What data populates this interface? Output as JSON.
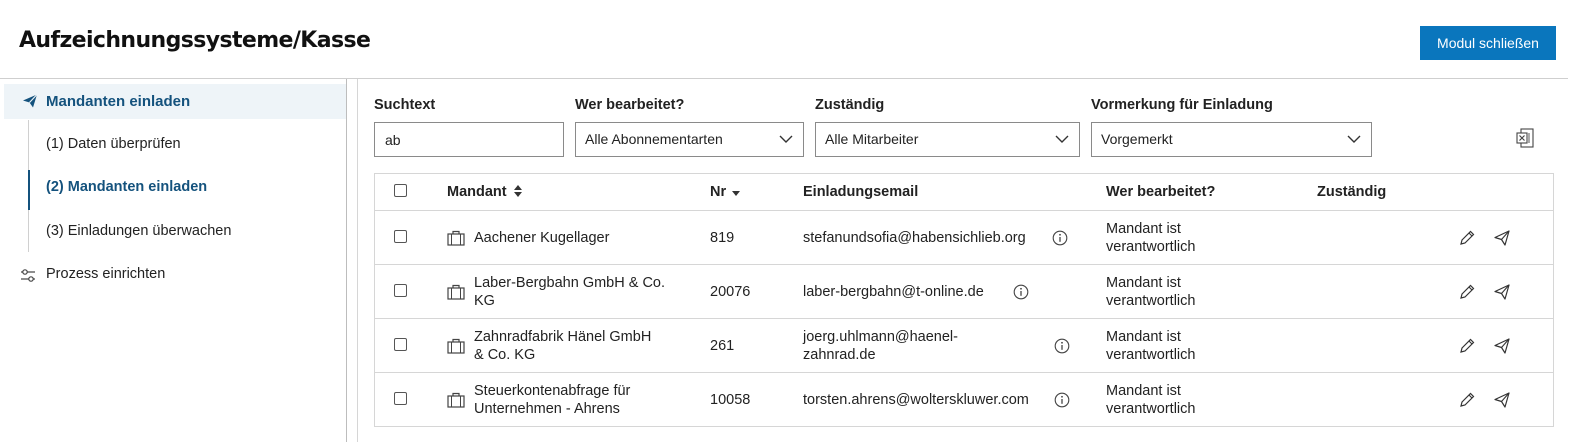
{
  "header": {
    "title": "Aufzeichnungssysteme/Kasse",
    "close_button": "Modul schließen"
  },
  "sidebar": {
    "main_item": "Mandanten einladen",
    "sub_items": [
      "(1) Daten überprüfen",
      "(2) Mandanten einladen",
      "(3) Einladungen überwachen"
    ],
    "process_item": "Prozess einrichten"
  },
  "filters": {
    "search": {
      "label": "Suchtext",
      "value": "ab"
    },
    "editor": {
      "label": "Wer bearbeitet?",
      "value": "Alle Abonnementarten"
    },
    "responsible": {
      "label": "Zuständig",
      "value": "Alle Mitarbeiter"
    },
    "reservation": {
      "label": "Vormerkung für Einladung",
      "value": "Vorgemerkt"
    }
  },
  "table": {
    "columns": {
      "client": "Mandant",
      "nr": "Nr",
      "email": "Einladungsemail",
      "editor": "Wer bearbeitet?",
      "responsible": "Zuständig"
    },
    "rows": [
      {
        "name": [
          "Aachener Kugellager",
          ""
        ],
        "nr": "819",
        "email": [
          "stefanundsofia@habensichlieb.org",
          ""
        ],
        "editor": [
          "Mandant ist",
          "verantwortlich"
        ],
        "responsible": ""
      },
      {
        "name": [
          "Laber-Bergbahn GmbH & Co.",
          "KG"
        ],
        "nr": "20076",
        "email": [
          "laber-bergbahn@t-online.de",
          ""
        ],
        "editor": [
          "Mandant ist",
          "verantwortlich"
        ],
        "responsible": ""
      },
      {
        "name": [
          "Zahnradfabrik Hänel GmbH",
          "& Co. KG"
        ],
        "nr": "261",
        "email": [
          "joerg.uhlmann@haenel-",
          "zahnrad.de"
        ],
        "editor": [
          "Mandant ist",
          "verantwortlich"
        ],
        "responsible": ""
      },
      {
        "name": [
          "Steuerkontenabfrage für",
          "Unternehmen - Ahrens"
        ],
        "nr": "10058",
        "email": [
          "torsten.ahrens@wolterskluwer.com",
          ""
        ],
        "editor": [
          "Mandant ist",
          "verantwortlich"
        ],
        "responsible": ""
      }
    ]
  },
  "icons": {
    "send": "paper-plane-icon",
    "edit": "pencil-icon",
    "client": "briefcase-icon",
    "info": "info-icon",
    "export": "excel-export-icon",
    "process": "sliders-icon"
  },
  "colors": {
    "accent": "#0a76bd",
    "nav_active": "#14527d",
    "nav_bg": "#eef4f8"
  }
}
